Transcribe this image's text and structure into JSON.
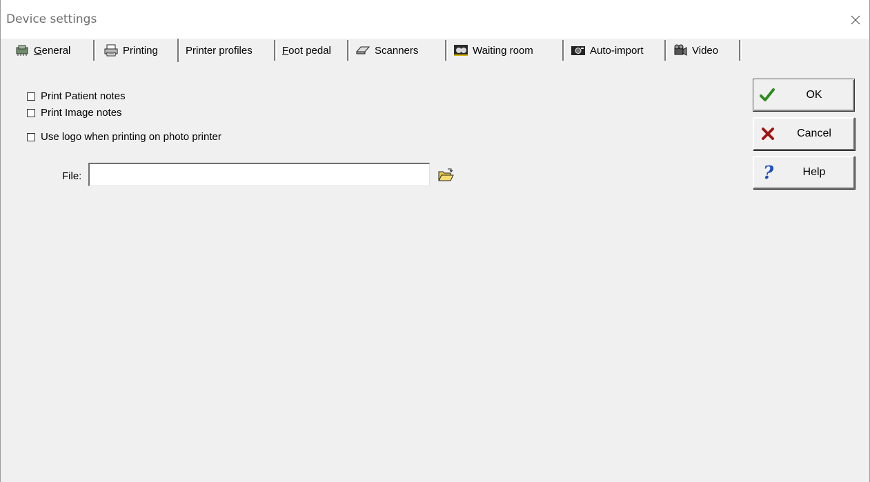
{
  "window": {
    "title": "Device settings",
    "close_icon": "close-icon"
  },
  "tabs": [
    {
      "label_pre": "",
      "label_ul": "G",
      "label_post": "eneral",
      "icon": "cpu-chip-icon",
      "active": false
    },
    {
      "label_pre": "",
      "label_ul": "",
      "label_post": "Printing",
      "icon": "printer-icon",
      "active": true
    },
    {
      "label_pre": "",
      "label_ul": "",
      "label_post": "Printer profiles",
      "icon": "",
      "active": false
    },
    {
      "label_pre": "",
      "label_ul": "F",
      "label_post": "oot pedal",
      "icon": "",
      "active": false
    },
    {
      "label_pre": "",
      "label_ul": "",
      "label_post": "Scanners",
      "icon": "scanner-icon",
      "active": false
    },
    {
      "label_pre": "",
      "label_ul": "",
      "label_post": "Waiting room",
      "icon": "waiting-room-icon",
      "active": false
    },
    {
      "label_pre": "",
      "label_ul": "",
      "label_post": "Auto-import",
      "icon": "camera-icon",
      "active": false
    },
    {
      "label_pre": "",
      "label_ul": "",
      "label_post": "Video",
      "icon": "video-camera-icon",
      "active": false
    }
  ],
  "printing": {
    "print_patient_notes": {
      "label": "Print Patient notes",
      "checked": false
    },
    "print_image_notes": {
      "label": "Print Image notes",
      "checked": false
    },
    "use_logo": {
      "label": "Use logo when printing on photo printer",
      "checked": false
    },
    "file_label": "File:",
    "file_value": ""
  },
  "buttons": {
    "ok": "OK",
    "cancel": "Cancel",
    "help": "Help"
  },
  "colors": {
    "ok_check": "#2e8b1e",
    "cancel_x": "#a01414",
    "help_q": "#1f4fbf"
  }
}
